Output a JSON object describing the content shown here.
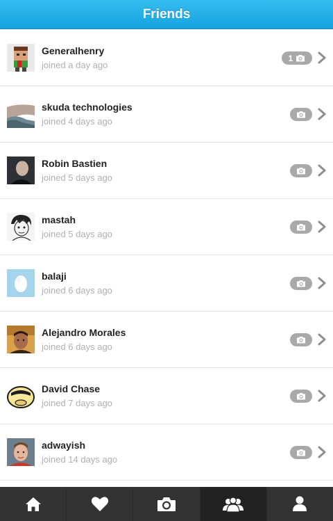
{
  "header": {
    "title": "Friends"
  },
  "friends": [
    {
      "name": "Generalhenry",
      "joined": "joined a day ago",
      "photo_count": "1",
      "avatar_icon": "pixel-character-avatar"
    },
    {
      "name": "skuda technologies",
      "joined": "joined 4 days ago",
      "photo_count": "",
      "avatar_icon": "landscape-wave-avatar"
    },
    {
      "name": "Robin Bastien",
      "joined": "joined 5 days ago",
      "photo_count": "",
      "avatar_icon": "person-photo-avatar"
    },
    {
      "name": "mastah",
      "joined": "joined 5 days ago",
      "photo_count": "",
      "avatar_icon": "sketch-face-avatar"
    },
    {
      "name": "balaji",
      "joined": "joined 6 days ago",
      "photo_count": "",
      "avatar_icon": "default-egg-avatar"
    },
    {
      "name": "Alejandro Morales",
      "joined": "joined 6 days ago",
      "photo_count": "",
      "avatar_icon": "person-photo-avatar"
    },
    {
      "name": "David Chase",
      "joined": "joined 7 days ago",
      "photo_count": "",
      "avatar_icon": "cartoon-face-avatar"
    },
    {
      "name": "adwayish",
      "joined": "joined 14 days ago",
      "photo_count": "",
      "avatar_icon": "person-photo-avatar"
    }
  ],
  "tabbar": {
    "tabs": [
      {
        "icon": "home-icon",
        "active": false
      },
      {
        "icon": "heart-icon",
        "active": false
      },
      {
        "icon": "camera-icon",
        "active": false
      },
      {
        "icon": "friends-icon",
        "active": true
      },
      {
        "icon": "profile-icon",
        "active": false
      }
    ]
  },
  "colors": {
    "header_gradient_top": "#34bdf0",
    "header_gradient_bottom": "#15a2dd",
    "tabbar_bg": "#333333",
    "tab_active_bg": "#222222",
    "photo_pill_bg": "#a9a9a9"
  }
}
